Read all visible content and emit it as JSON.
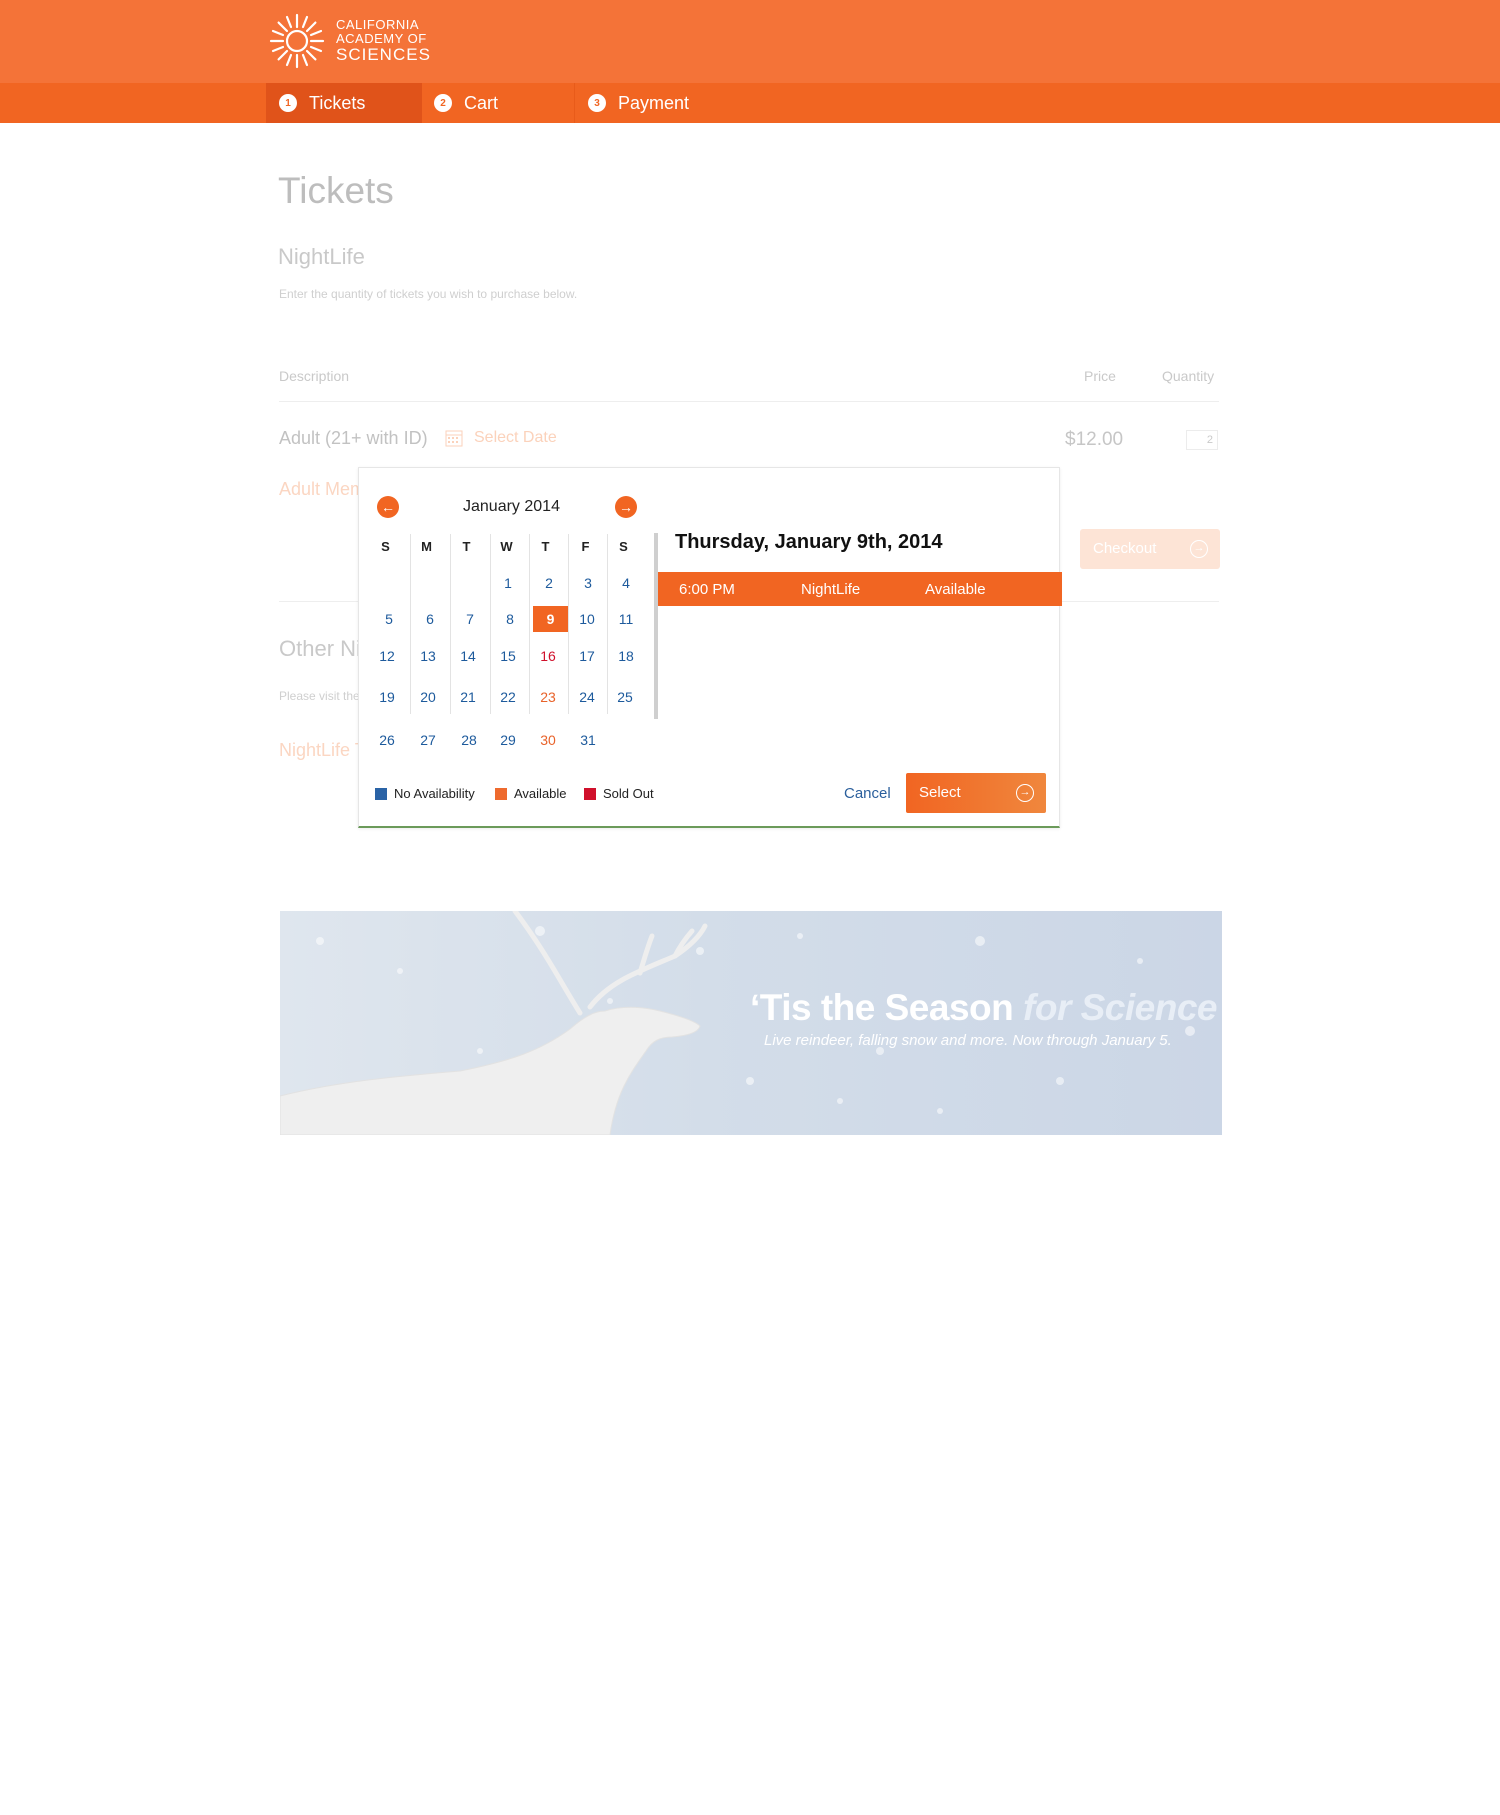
{
  "brand": {
    "line1": "CALIFORNIA",
    "line2": "ACADEMY OF",
    "line3": "SCIENCES",
    "color": "#f47338"
  },
  "steps": [
    {
      "num": "1",
      "label": "Tickets",
      "active": true
    },
    {
      "num": "2",
      "label": "Cart",
      "active": false
    },
    {
      "num": "3",
      "label": "Payment",
      "active": false
    }
  ],
  "page": {
    "title": "Tickets",
    "section": "NightLife",
    "intro": "Enter the quantity of tickets you wish to purchase below.",
    "columns": {
      "description": "Description",
      "price": "Price",
      "quantity": "Quantity"
    },
    "ticket": {
      "label": "Adult (21+ with ID)",
      "select_date": "Select Date",
      "price": "$12.00",
      "quantity": "2"
    },
    "member_label": "Adult Member",
    "checkout": "Checkout",
    "other_title": "Other NightLife",
    "please_visit": "Please visit the",
    "nightlife_link": "NightLife Tickets"
  },
  "banner": {
    "title_main": "‘Tis the Season",
    "title_accent": "for Science",
    "subtitle": "Live reindeer, falling snow and more. Now through January 5."
  },
  "calendar": {
    "month": "January 2014",
    "dows": [
      "S",
      "M",
      "T",
      "W",
      "T",
      "F",
      "S"
    ],
    "selected_heading": "Thursday, January 9th, 2014",
    "slot": {
      "time": "6:00 PM",
      "event": "NightLife",
      "status": "Available"
    },
    "legend": [
      {
        "label": "No Availability",
        "color": "#2a63a6"
      },
      {
        "label": "Available",
        "color": "#ee6a2e"
      },
      {
        "label": "Sold Out",
        "color": "#d0102b"
      }
    ],
    "cancel": "Cancel",
    "select": "Select"
  }
}
